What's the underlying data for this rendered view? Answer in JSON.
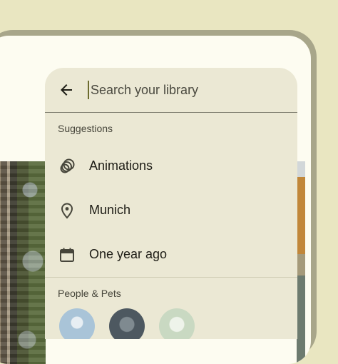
{
  "search": {
    "placeholder": "Search your library",
    "value": ""
  },
  "suggestions": {
    "heading": "Suggestions",
    "items": [
      {
        "label": "Animations",
        "icon": "animation-icon"
      },
      {
        "label": "Munich",
        "icon": "location-pin-icon"
      },
      {
        "label": "One year ago",
        "icon": "calendar-icon"
      }
    ]
  },
  "people": {
    "heading": "People & Pets",
    "avatars": [
      {
        "color": "#a9c4d8"
      },
      {
        "color": "#4d5860"
      },
      {
        "color": "#c9d9c2"
      }
    ]
  },
  "colors": {
    "panel": "#ebe8d4",
    "outer": "#e9e6c1",
    "accent": "#6c6b2e"
  }
}
